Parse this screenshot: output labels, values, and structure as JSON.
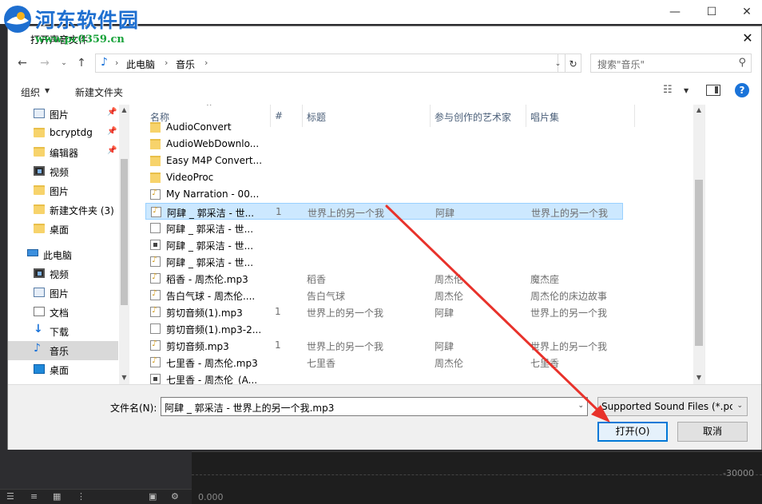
{
  "watermark": {
    "title": "河东软件园",
    "url": "www.pc0359.cn"
  },
  "background": {
    "ruler_value": "-30000",
    "time": "0.000"
  },
  "dialog": {
    "title": "打开声音文件",
    "address": {
      "crumbs": [
        "此电脑",
        "音乐"
      ]
    },
    "search_placeholder": "搜索\"音乐\"",
    "toolbar": {
      "organize": "组织",
      "new_folder": "新建文件夹"
    },
    "nav_items": [
      {
        "label": "图片",
        "icon": "picture-icon",
        "pinned": true
      },
      {
        "label": "bcryptdg",
        "icon": "folder-icon",
        "pinned": true
      },
      {
        "label": "编辑器",
        "icon": "folder-icon",
        "pinned": true
      },
      {
        "label": "视频",
        "icon": "video-icon",
        "pinned": false
      },
      {
        "label": "图片",
        "icon": "folder-icon",
        "pinned": false
      },
      {
        "label": "新建文件夹 (3)",
        "icon": "folder-icon",
        "pinned": false
      },
      {
        "label": "桌面",
        "icon": "folder-icon",
        "pinned": false
      },
      {
        "label": "此电脑",
        "icon": "computer-icon",
        "pinned": false
      },
      {
        "label": "视频",
        "icon": "video-icon",
        "pinned": false
      },
      {
        "label": "图片",
        "icon": "picture-icon",
        "pinned": false
      },
      {
        "label": "文档",
        "icon": "document-icon",
        "pinned": false
      },
      {
        "label": "下载",
        "icon": "download-icon",
        "pinned": false
      },
      {
        "label": "音乐",
        "icon": "music-icon",
        "pinned": false,
        "selected": true
      },
      {
        "label": "桌面",
        "icon": "desktop-icon",
        "pinned": false
      }
    ],
    "columns": {
      "name": "名称",
      "number": "#",
      "title": "标题",
      "artist": "参与创作的艺术家",
      "album": "唱片集"
    },
    "files": [
      {
        "name": "AudioConvert",
        "type": "folder",
        "number": "",
        "title": "",
        "artist": "",
        "album": ""
      },
      {
        "name": "AudioWebDownlo...",
        "type": "folder",
        "number": "",
        "title": "",
        "artist": "",
        "album": ""
      },
      {
        "name": "Easy M4P Convert...",
        "type": "folder",
        "number": "",
        "title": "",
        "artist": "",
        "album": ""
      },
      {
        "name": "VideoProc",
        "type": "folder",
        "number": "",
        "title": "",
        "artist": "",
        "album": ""
      },
      {
        "name": "My Narration - 00...",
        "type": "audio",
        "number": "",
        "title": "",
        "artist": "",
        "album": ""
      },
      {
        "name": "阿肆 _ 郭采洁 - 世...",
        "type": "audio",
        "number": "1",
        "title": "世界上的另一个我",
        "artist": "阿肆",
        "album": "世界上的另一个我",
        "selected": true
      },
      {
        "name": "阿肆 _ 郭采洁 - 世...",
        "type": "doc",
        "number": "",
        "title": "",
        "artist": "",
        "album": ""
      },
      {
        "name": "阿肆 _ 郭采洁 - 世...",
        "type": "exe",
        "number": "",
        "title": "",
        "artist": "",
        "album": ""
      },
      {
        "name": "阿肆 _ 郭采洁 - 世...",
        "type": "audio",
        "number": "",
        "title": "",
        "artist": "",
        "album": ""
      },
      {
        "name": "稻香 - 周杰伦.mp3",
        "type": "audio",
        "number": "",
        "title": "稻香",
        "artist": "周杰伦",
        "album": "魔杰座"
      },
      {
        "name": "告白气球 - 周杰伦....",
        "type": "audio",
        "number": "",
        "title": "告白气球",
        "artist": "周杰伦",
        "album": "周杰伦的床边故事"
      },
      {
        "name": "剪切音频(1).mp3",
        "type": "audio",
        "number": "1",
        "title": "世界上的另一个我",
        "artist": "阿肆",
        "album": "世界上的另一个我"
      },
      {
        "name": "剪切音频(1).mp3-2...",
        "type": "doc",
        "number": "",
        "title": "",
        "artist": "",
        "album": ""
      },
      {
        "name": "剪切音频.mp3",
        "type": "audio",
        "number": "1",
        "title": "世界上的另一个我",
        "artist": "阿肆",
        "album": "世界上的另一个我"
      },
      {
        "name": "七里香 - 周杰伦.mp3",
        "type": "audio",
        "number": "",
        "title": "七里香",
        "artist": "周杰伦",
        "album": "七里香"
      },
      {
        "name": "七里香 - 周杰伦_(A...",
        "type": "exe",
        "number": "",
        "title": "",
        "artist": "",
        "album": ""
      }
    ],
    "filename_label": "文件名(N):",
    "filename_value": "阿肆 _ 郭采洁 - 世界上的另一个我.mp3",
    "filetype_value": "Supported Sound Files (*.pcm",
    "open_button": "打开(O)",
    "cancel_button": "取消"
  },
  "colors": {
    "accent": "#0078d7",
    "selection": "#cce8ff",
    "annotation": "#e8322b"
  }
}
